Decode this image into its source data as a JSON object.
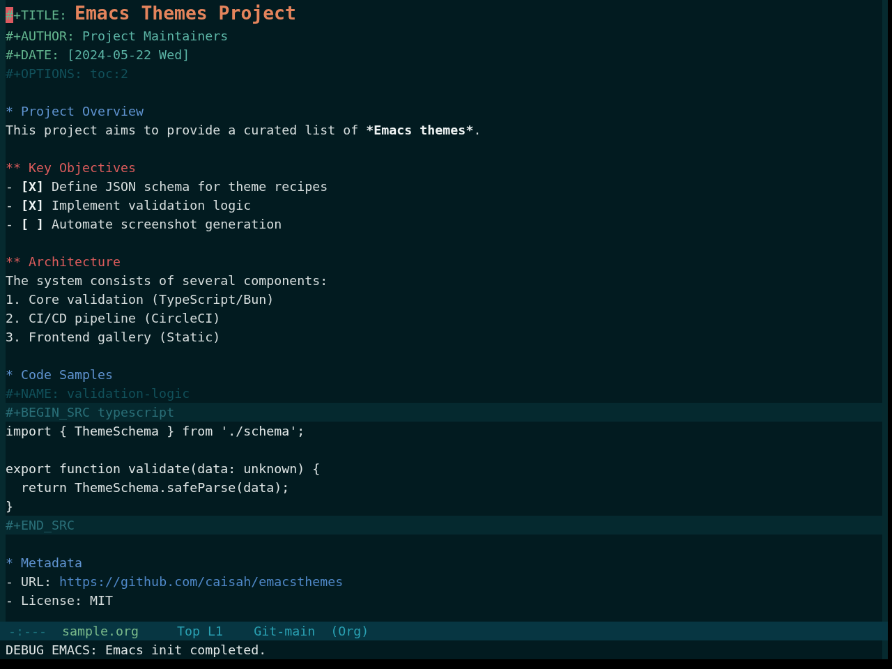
{
  "buffer": {
    "keywords": [
      {
        "kind": "title",
        "keyword": "#+TITLE:",
        "value": "Emacs Themes Project",
        "cursor": true
      },
      {
        "kind": "meta",
        "keyword": "#+AUTHOR:",
        "value": "Project Maintainers",
        "cursor": false
      },
      {
        "kind": "meta",
        "keyword": "#+DATE:",
        "value": "[2024-05-22 Wed]",
        "cursor": false
      },
      {
        "kind": "option",
        "keyword": "#+OPTIONS:",
        "value": "toc:2",
        "cursor": false
      }
    ],
    "sections": [
      {
        "heading": "* Project Overview",
        "body": [
          {
            "kind": "text",
            "parts": [
              {
                "kind": "plain",
                "text": "This project aims to provide a curated list of "
              },
              {
                "kind": "bold",
                "text": "*Emacs themes*"
              },
              {
                "kind": "plain",
                "text": "."
              }
            ]
          }
        ],
        "children": [
          {
            "heading": "** Key Objectives",
            "body": [
              {
                "kind": "text",
                "parts": [
                  {
                    "kind": "plain",
                    "text": "- "
                  },
                  {
                    "kind": "bold",
                    "text": "[X]"
                  },
                  {
                    "kind": "plain",
                    "text": " Define JSON schema for theme recipes"
                  }
                ]
              },
              {
                "kind": "text",
                "parts": [
                  {
                    "kind": "plain",
                    "text": "- "
                  },
                  {
                    "kind": "bold",
                    "text": "[X]"
                  },
                  {
                    "kind": "plain",
                    "text": " Implement validation logic"
                  }
                ]
              },
              {
                "kind": "text",
                "parts": [
                  {
                    "kind": "plain",
                    "text": "- "
                  },
                  {
                    "kind": "bold",
                    "text": "[ ]"
                  },
                  {
                    "kind": "plain",
                    "text": " Automate screenshot generation"
                  }
                ]
              }
            ]
          },
          {
            "heading": "** Architecture",
            "body": [
              {
                "kind": "text",
                "parts": [
                  {
                    "kind": "plain",
                    "text": "The system consists of several components:"
                  }
                ]
              },
              {
                "kind": "text",
                "parts": [
                  {
                    "kind": "plain",
                    "text": "1. Core validation (TypeScript/Bun)"
                  }
                ]
              },
              {
                "kind": "text",
                "parts": [
                  {
                    "kind": "plain",
                    "text": "2. CI/CD pipeline (CircleCI)"
                  }
                ]
              },
              {
                "kind": "text",
                "parts": [
                  {
                    "kind": "plain",
                    "text": "3. Frontend gallery (Static)"
                  }
                ]
              }
            ]
          }
        ]
      },
      {
        "heading": "* Code Samples",
        "body": [
          {
            "kind": "src_block",
            "name_line": "#+NAME: validation-logic",
            "begin": "#+BEGIN_SRC typescript",
            "code": "import { ThemeSchema } from './schema';\n\nexport function validate(data: unknown) {\n  return ThemeSchema.safeParse(data);\n}",
            "end": "#+END_SRC"
          }
        ]
      },
      {
        "heading": "* Metadata",
        "body": [
          {
            "kind": "text",
            "parts": [
              {
                "kind": "plain",
                "text": "- URL: "
              },
              {
                "kind": "link",
                "text": "https://github.com/caisah/emacsthemes"
              }
            ]
          },
          {
            "kind": "text",
            "parts": [
              {
                "kind": "plain",
                "text": "- License: MIT"
              }
            ]
          }
        ]
      }
    ]
  },
  "mode_line": [
    {
      "kind": "status",
      "text": "-:---"
    },
    {
      "kind": "buffer",
      "text": "sample.org"
    },
    {
      "kind": "position",
      "text": "Top L1"
    },
    {
      "kind": "vc",
      "text": "Git-main"
    },
    {
      "kind": "mode",
      "text": "(Org)"
    }
  ],
  "echo_area": "DEBUG EMACS: Emacs init completed."
}
